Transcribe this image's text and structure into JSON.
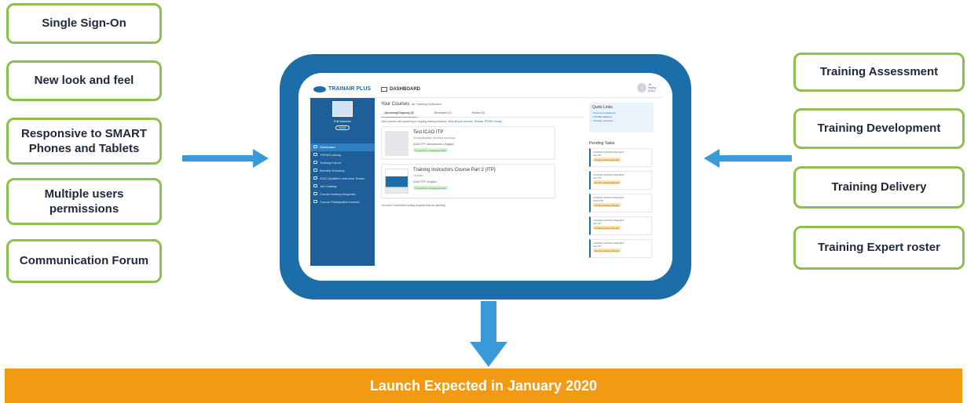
{
  "features_left": [
    {
      "label": "Single Sign-On"
    },
    {
      "label": "New look and feel"
    },
    {
      "label": "Responsive to SMART Phones and Tablets"
    },
    {
      "label": "Multiple users permissions"
    },
    {
      "label": "Communication Forum"
    }
  ],
  "features_right": [
    {
      "label": "Training Assessment"
    },
    {
      "label": "Training Development"
    },
    {
      "label": "Training Delivery"
    },
    {
      "label": "Training Expert roster"
    }
  ],
  "banner": {
    "label": "Launch Expected in January 2020"
  },
  "colors": {
    "box_border": "#8cc04b",
    "arrow": "#3a9ad9",
    "frame": "#1b6ea8",
    "sidebar": "#1e5f99",
    "banner": "#f29a12"
  },
  "app": {
    "logo_text": "TRAINAIR PLUS",
    "page_title": "DASHBOARD",
    "user_name": "Jie Huang ICAO",
    "sidebar": {
      "member_label": "Full Member",
      "details_button": "Details",
      "nav": [
        {
          "label": "Dashboard",
          "icon": "monitor-icon"
        },
        {
          "label": "TPEMS Library",
          "icon": "folder-icon"
        },
        {
          "label": "Training Forum",
          "icon": "forum-icon"
        },
        {
          "label": "Member Directory",
          "icon": "globe-icon"
        },
        {
          "label": "ICAO Qualified Instructor Roster",
          "icon": "person-icon"
        },
        {
          "label": "Job Catalog",
          "icon": "briefcase-icon"
        },
        {
          "label": "Course Hosting Requests",
          "icon": "calendar-icon"
        },
        {
          "label": "Course Participation Interest",
          "icon": "star-icon"
        }
      ]
    },
    "main": {
      "heading": "Your Courses",
      "heading_sub": "as Training Institution",
      "tabs": [
        {
          "label": "Upcoming/Ongoing (2)"
        },
        {
          "label": "Developed (0)"
        },
        {
          "label": "Hosted (0)"
        }
      ],
      "intro": "View courses with upcoming or ongoing training sessions.",
      "intro_link1": "View all your courses",
      "intro_link2": "Browse TPEMS Library",
      "courses": [
        {
          "title": "Test ICAO ITP",
          "subtitle": "STANDARDIZED TRAINING PACKAGE",
          "meta": "ICAO ITP • Aerodromes • English",
          "badge": "1 upcoming / ongoing session"
        },
        {
          "title": "Training Instructors Course Part 2 (ITP)",
          "subtitle": "TICOSP2",
          "meta": "ICAO ITP • English",
          "badge": "1 upcoming / ongoing session"
        }
      ],
      "hosting_note": "You have 0 submitted hosting requests that are pending."
    },
    "quick_links": {
      "title": "Quick Links",
      "items": [
        "Tools and Guidelines",
        "STORE Statistics",
        "Develop a Course"
      ]
    },
    "pending": {
      "title": "Pending Tasks",
      "tasks": [
        {
          "type": "COURSE HOSTING REQUEST",
          "name": "test ITP",
          "badge": "Pending hosting Request"
        },
        {
          "type": "COURSE HOSTING REQUEST",
          "name": "test ITP",
          "badge": "Pending hosting Request"
        },
        {
          "type": "COURSE HOSTING REQUEST",
          "name": "Test ICTP",
          "badge": "Pending hosting Request"
        },
        {
          "type": "COURSE HOSTING REQUEST",
          "name": "test ITP",
          "badge": "Pending hosting Request"
        },
        {
          "type": "COURSE HOSTING REQUEST",
          "name": "test ITP",
          "badge": "Pending hosting Request"
        }
      ]
    }
  }
}
